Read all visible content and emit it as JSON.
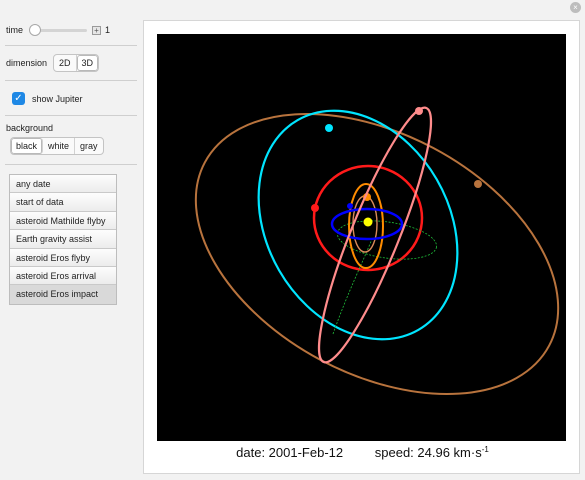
{
  "controls": {
    "time_label": "time",
    "time_value": "1",
    "time_fraction": 0,
    "dimension_label": "dimension",
    "dimension_options": [
      "2D",
      "3D"
    ],
    "dimension_selected": "3D",
    "show_jupiter_label": "show Jupiter",
    "show_jupiter_checked": true,
    "background_label": "background",
    "background_options": [
      "black",
      "white",
      "gray"
    ],
    "background_selected": "black"
  },
  "events": [
    "any date",
    "start of data",
    "asteroid Mathilde flyby",
    "Earth gravity assist",
    "asteroid Eros flyby",
    "asteroid Eros arrival",
    "asteroid Eros impact"
  ],
  "events_selected": "asteroid Eros impact",
  "readout": {
    "date": "date: 2001-Feb-12",
    "speed_prefix": "speed: 24.96 km·s",
    "speed_exponent": "-1"
  },
  "colors": {
    "sun": "#ffff00",
    "mercury": "#0000ff",
    "venus": "#ff8c00",
    "earth": "#ff1a1a",
    "mars": "#00e5ff",
    "jupiter": "#b8733d",
    "asteroid": "#ff8c8c",
    "spacecraft_path": "#1fbf3a",
    "accent": "#1e88e5"
  },
  "icons": [
    "plus-icon",
    "check-icon",
    "close-icon"
  ]
}
